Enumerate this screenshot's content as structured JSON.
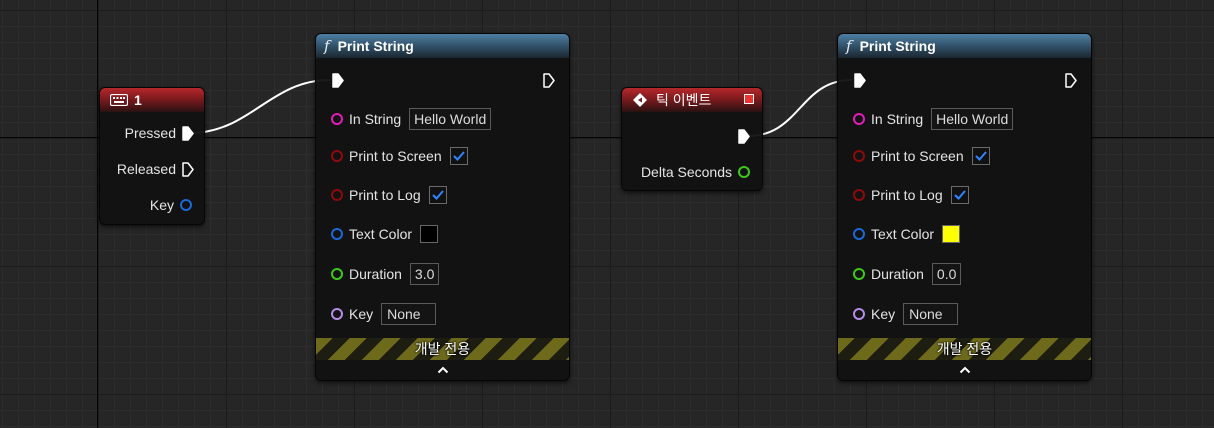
{
  "colors": {
    "exec": "#ffffff",
    "string_pin": "#e01cb9",
    "bool_pin": "#8e0b0b",
    "struct_pin": "#1a69d6",
    "float_pin": "#3dc91a",
    "key_pin": "#b58de6",
    "check": "#2e86ff",
    "hazard": "#6e6a1c"
  },
  "key_event": {
    "title": "1",
    "icon": "keyboard-icon",
    "pins": {
      "pressed": "Pressed",
      "released": "Released",
      "key": "Key"
    }
  },
  "print_string_1": {
    "title": "Print String",
    "icon": "function-icon",
    "in_string_label": "In String",
    "in_string_value": "Hello World",
    "print_to_screen_label": "Print to Screen",
    "print_to_screen": true,
    "print_to_log_label": "Print to Log",
    "print_to_log": true,
    "text_color_label": "Text Color",
    "text_color": "#000000",
    "duration_label": "Duration",
    "duration_value": "3.0",
    "key_label": "Key",
    "key_value": "None",
    "footer": "개발 전용",
    "collapse_icon": "chevron-up-icon"
  },
  "tick_event": {
    "title": "틱 이벤트",
    "icon": "event-icon",
    "delta_seconds_label": "Delta Seconds"
  },
  "print_string_2": {
    "title": "Print String",
    "icon": "function-icon",
    "in_string_label": "In String",
    "in_string_value": "Hello World",
    "print_to_screen_label": "Print to Screen",
    "print_to_screen": true,
    "print_to_log_label": "Print to Log",
    "print_to_log": true,
    "text_color_label": "Text Color",
    "text_color": "#ffff00",
    "duration_label": "Duration",
    "duration_value": "0.0",
    "key_label": "Key",
    "key_value": "None",
    "footer": "개발 전용",
    "collapse_icon": "chevron-up-icon"
  }
}
